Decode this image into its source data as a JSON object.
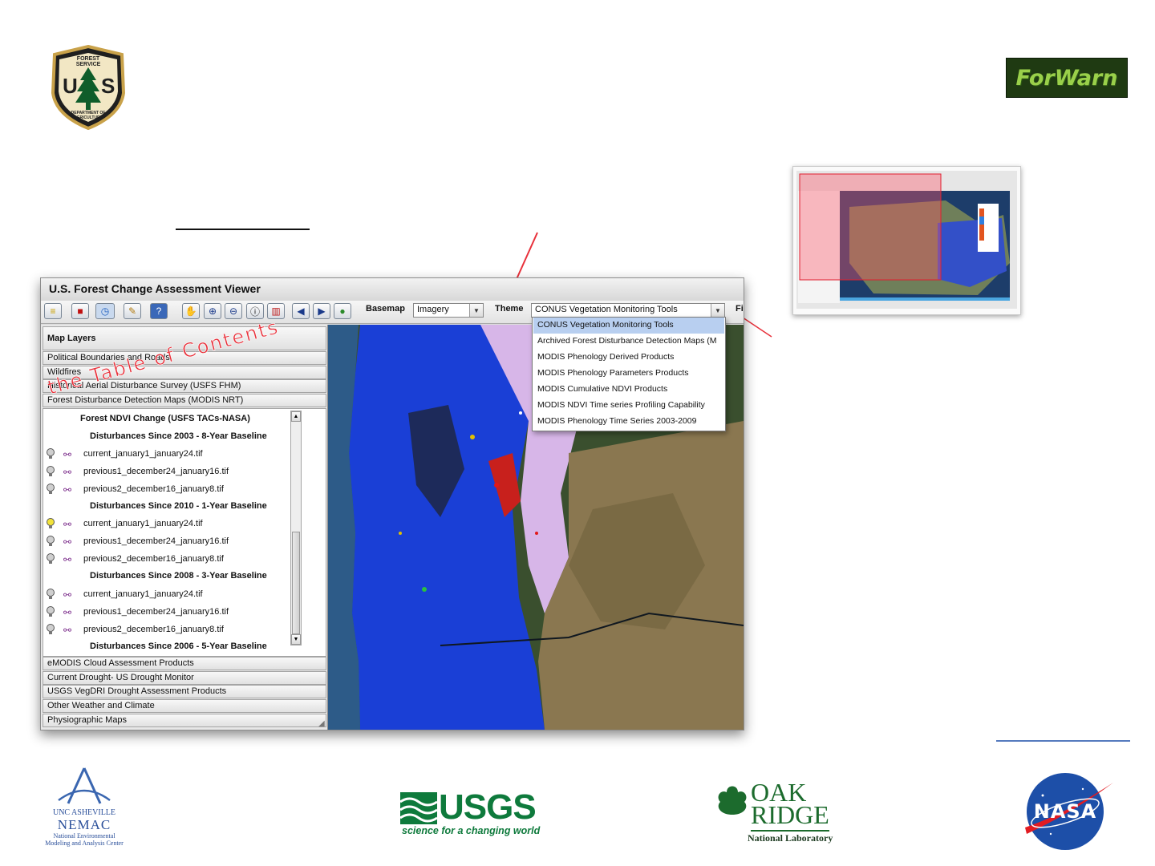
{
  "logos": {
    "forest_service": {
      "line1": "FOREST SERVICE",
      "line2": "U",
      "line3": "S",
      "line4": "DEPARTMENT OF AGRICULTURE"
    },
    "forwarn": "ForWarn",
    "nemac": {
      "line1": "UNC ASHEVILLE",
      "line2": "NEMAC",
      "line3": "National Environmental",
      "line4": "Modeling and Analysis Center"
    },
    "usgs": {
      "name": "USGS",
      "tagline": "science for a changing world"
    },
    "oak_ridge": {
      "line1": "OAK",
      "line2": "RIDGE",
      "line3": "National Laboratory"
    },
    "nasa": "NASA"
  },
  "annotation": "the Table of Contents",
  "app": {
    "title": "U.S. Forest Change Assessment Viewer",
    "toolbar": {
      "basemap_label": "Basemap",
      "basemap_value": "Imagery",
      "theme_label": "Theme",
      "theme_value": "CONUS Vegetation Monitoring Tools",
      "cut_label": "Fi"
    },
    "theme_options": [
      "CONUS Vegetation Monitoring Tools",
      "Archived Forest Disturbance Detection Maps (M",
      "MODIS Phenology Derived Products",
      "MODIS Phenology Parameters Products",
      "MODIS Cumulative NDVI Products",
      "MODIS NDVI Time series Profiling Capability",
      "MODIS Phenology Time Series 2003-2009"
    ],
    "panel": {
      "title": "Map Layers",
      "top_groups": [
        "Political Boundaries and Roads",
        "Wildfires",
        "Historical Aerial Disturbance Survey (USFS FHM)",
        "Forest Disturbance Detection Maps (MODIS NRT)"
      ],
      "subgroup": "Forest NDVI Change (USFS TACs-NASA)",
      "sections": [
        {
          "heading": "Disturbances Since 2003 - 8-Year Baseline",
          "layers": [
            "current_january1_january24.tif",
            "previous1_december24_january16.tif",
            "previous2_december16_january8.tif"
          ]
        },
        {
          "heading": "Disturbances Since 2010 - 1-Year Baseline",
          "layers": [
            "current_january1_january24.tif",
            "previous1_december24_january16.tif",
            "previous2_december16_january8.tif"
          ]
        },
        {
          "heading": "Disturbances Since 2008 - 3-Year Baseline",
          "layers": [
            "current_january1_january24.tif",
            "previous1_december24_january16.tif",
            "previous2_december16_january8.tif"
          ]
        }
      ],
      "cut_heading": "Disturbances Since 2006 - 5-Year Baseline",
      "bottom_groups": [
        "eMODIS Cloud Assessment Products",
        "Current Drought- US Drought Monitor",
        "USGS VegDRI Drought Assessment Products",
        "Other Weather and Climate",
        "Physiographic Maps"
      ]
    }
  },
  "colors": {
    "annotation": "#e8303a",
    "forwarn_bg": "#1f3a12",
    "forwarn_text": "#9ad04a",
    "usgs_green": "#0e7a3c",
    "oak_green": "#1c6b2d",
    "nasa_blue": "#1d4fa8",
    "selection": "#b8cff0"
  }
}
